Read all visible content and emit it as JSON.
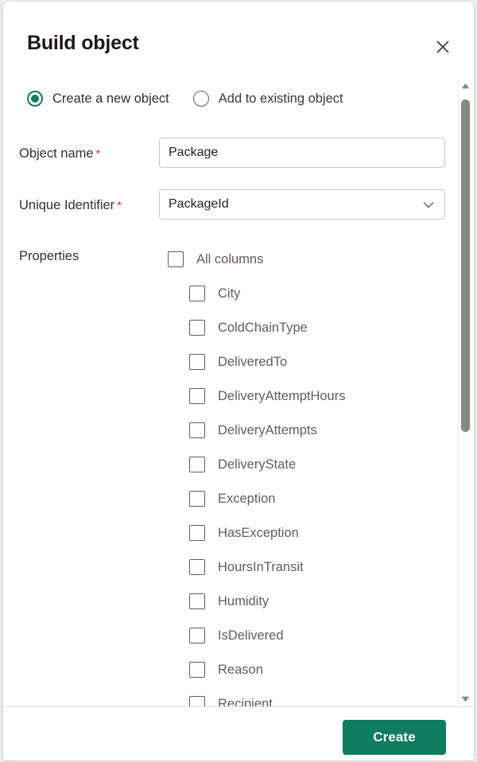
{
  "dialog": {
    "title": "Build object",
    "close_icon": "close-icon"
  },
  "mode": {
    "options": [
      {
        "label": "Create a new object",
        "selected": true
      },
      {
        "label": "Add to existing object",
        "selected": false
      }
    ]
  },
  "form": {
    "object_name": {
      "label": "Object name",
      "required_marker": "*",
      "value": "Package",
      "placeholder": ""
    },
    "unique_identifier": {
      "label": "Unique Identifier",
      "required_marker": "*",
      "value": "PackageId",
      "caret_icon": "chevron-down-icon"
    },
    "properties": {
      "label": "Properties",
      "all_columns": {
        "label": "All columns",
        "checked": false
      },
      "items": [
        {
          "label": "City",
          "checked": false
        },
        {
          "label": "ColdChainType",
          "checked": false
        },
        {
          "label": "DeliveredTo",
          "checked": false
        },
        {
          "label": "DeliveryAttemptHours",
          "checked": false
        },
        {
          "label": "DeliveryAttempts",
          "checked": false
        },
        {
          "label": "DeliveryState",
          "checked": false
        },
        {
          "label": "Exception",
          "checked": false
        },
        {
          "label": "HasException",
          "checked": false
        },
        {
          "label": "HoursInTransit",
          "checked": false
        },
        {
          "label": "Humidity",
          "checked": false
        },
        {
          "label": "IsDelivered",
          "checked": false
        },
        {
          "label": "Reason",
          "checked": false
        },
        {
          "label": "Recipient",
          "checked": false
        }
      ]
    }
  },
  "scrollbar": {
    "up_icon": "triangle-up-icon",
    "down_icon": "triangle-down-icon"
  },
  "footer": {
    "create_label": "Create"
  },
  "colors": {
    "accent": "#107c5e",
    "required": "#d13438",
    "text": "#323130",
    "muted_text": "#605e5c",
    "border": "#c8c6c4"
  }
}
